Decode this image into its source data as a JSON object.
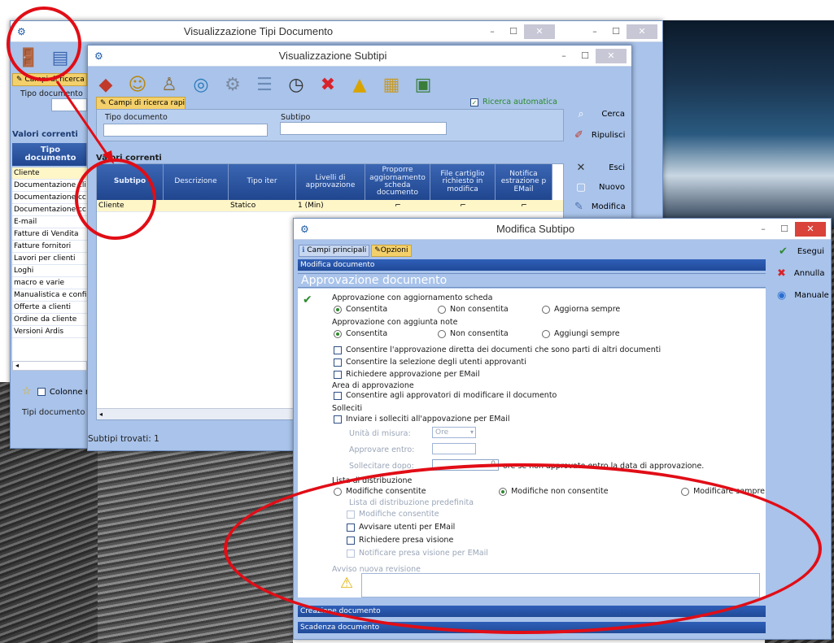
{
  "win1": {
    "title": "Visualizzazione Tipi Documento",
    "search_tab": "Campi di ricerca",
    "tipo_documento_label": "Tipo documento",
    "valori_correnti": "Valori correnti",
    "column_header": "Tipo documento",
    "rows": [
      "Cliente",
      "Documentazione cli",
      "Documentazione cc",
      "Documentazione cc",
      "E-mail",
      "Fatture di Vendita",
      "Fatture fornitori",
      "Lavori per clienti",
      "Loghi",
      "macro e varie",
      "Manualistica e confi",
      "Offerte a clienti",
      "Ordine da cliente",
      "Versioni Ardis"
    ],
    "colonne_label": "Colonne m",
    "status": "Tipi documento tro"
  },
  "win2": {
    "title": "Visualizzazione Subtipi",
    "search_tab": "Campi di ricerca rapida",
    "ricerca_automatica": "Ricerca automatica",
    "tipo_documento_label": "Tipo documento",
    "subtipo_label": "Subtipo",
    "cerca": "Cerca",
    "ripulisci": "Ripulisci",
    "esci": "Esci",
    "nuovo": "Nuovo",
    "modifica": "Modifica",
    "valori_correnti": "Valori correnti",
    "headers": [
      "Subtipo",
      "Descrizione",
      "Tipo iter",
      "Livelli di approvazione",
      "Proporre aggiornamento scheda documento",
      "File cartiglio richiesto in modifica",
      "Notifica estrazione p EMail"
    ],
    "row": {
      "subtipo": "Cliente",
      "descrizione": "",
      "tipo_iter": "Statico",
      "livelli": "1 (Min)"
    },
    "status": "Subtipi trovati: 1"
  },
  "win3": {
    "title": "Modifica Subtipo",
    "tab_main": "Campi principali",
    "tab_options": "Opzioni",
    "modifica_documento": "Modifica documento",
    "approvazione_documento": "Approvazione documento",
    "esegui": "Esegui",
    "annulla": "Annulla",
    "manuale": "Manuale",
    "appr_scheda_label": "Approvazione con aggiornamento scheda",
    "appr_scheda_opts": [
      "Consentita",
      "Non consentita",
      "Aggiorna sempre"
    ],
    "appr_note_label": "Approvazione con aggiunta note",
    "appr_note_opts": [
      "Consentita",
      "Non consentita",
      "Aggiungi sempre"
    ],
    "checks": [
      "Consentire l'approvazione diretta dei documenti che sono parti di altri documenti",
      "Consentire la selezione degli utenti approvanti",
      "Richiedere approvazione per EMail"
    ],
    "area_label": "Area di approvazione",
    "area_check": "Consentire agli approvatori di modificare il documento",
    "solleciti_label": "Solleciti",
    "solleciti_check": "Inviare i solleciti all'appovazione per EMail",
    "unita_label": "Unità di misura:",
    "unita_value": "Ore",
    "approvare_label": "Approvare entro:",
    "sollecitare_label": "Sollecitare dopo:",
    "sollecitare_value": "0",
    "sollecitare_suffix": "ore se non approvato entro la data di approvazione.",
    "lista_label": "Lista di distribuzione",
    "lista_opts": [
      "Modifiche consentite",
      "Modifiche non consentite",
      "Modificare sempre"
    ],
    "lista_pred_label": "Lista di distribuzione predefinita",
    "lista_checks": [
      "Modifiche consentite",
      "Avvisare utenti per EMail",
      "Richiedere presa visione",
      "Notificare presa visione per EMail"
    ],
    "avviso_label": "Avviso nuova revisione",
    "creazione": "Creazione documento",
    "scadenza": "Scadenza documento"
  }
}
